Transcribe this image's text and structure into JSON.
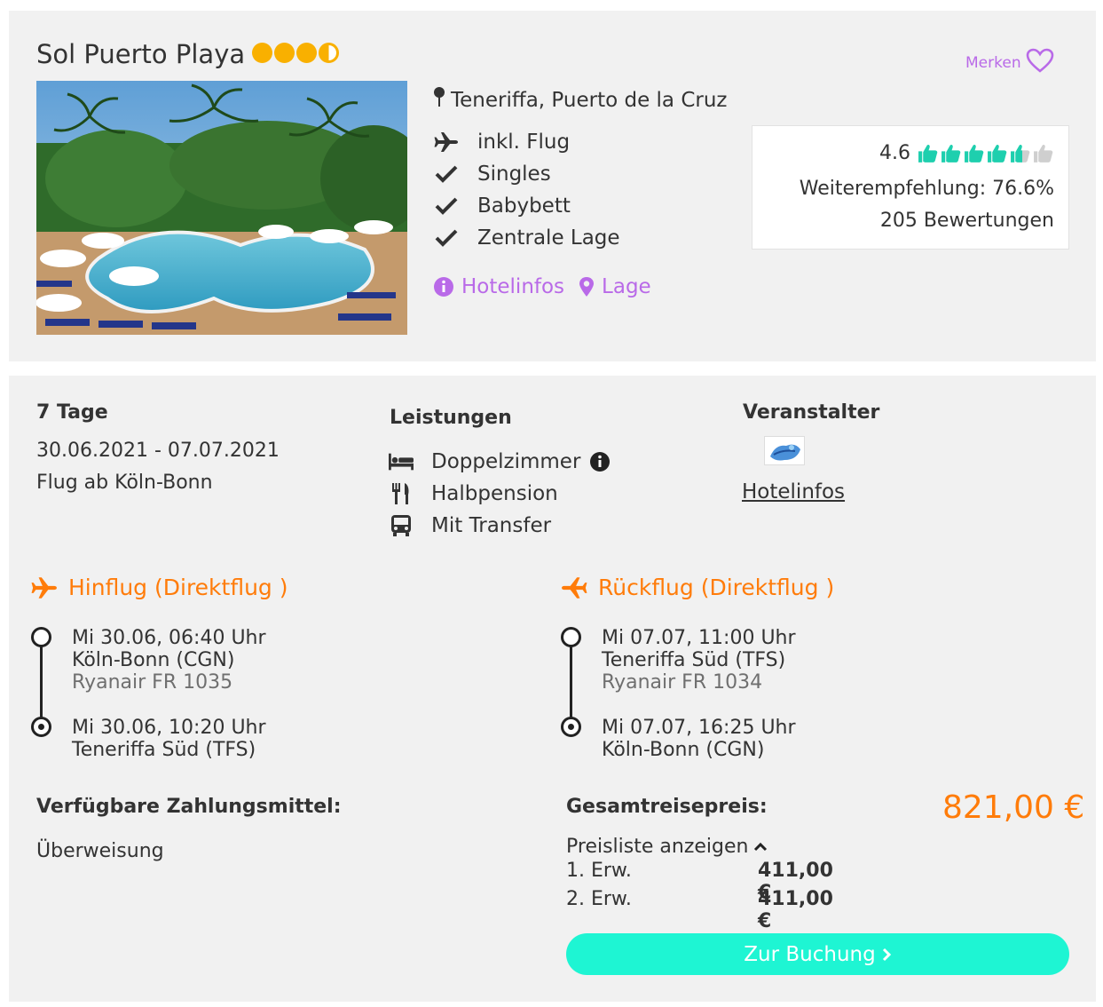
{
  "hotel": {
    "name": "Sol Puerto Playa",
    "stars": 3.5,
    "merken_label": "Merken",
    "location": "Teneriffa, Puerto de la Cruz",
    "features": [
      "inkl. Flug",
      "Singles",
      "Babybett",
      "Zentrale Lage"
    ],
    "feature_icons": [
      "plane-icon",
      "check-icon",
      "check-icon",
      "check-icon"
    ],
    "links": {
      "hotelinfos": "Hotelinfos",
      "lage": "Lage"
    },
    "rating": {
      "score": "4.6",
      "thumbs_filled": 4.6,
      "thumbs_total": 6,
      "recommendation": "Weiterempfehlung: 76.6%",
      "reviews": "205 Bewertungen"
    }
  },
  "trip": {
    "duration": "7 Tage",
    "dates": "30.06.2021 - 07.07.2021",
    "departure": "Flug ab Köln-Bonn"
  },
  "services": {
    "heading": "Leistungen",
    "items": [
      {
        "label": "Doppelzimmer",
        "icon": "bed-icon"
      },
      {
        "label": "Halbpension",
        "icon": "cutlery-icon"
      },
      {
        "label": "Mit Transfer",
        "icon": "bus-icon"
      }
    ]
  },
  "operator": {
    "heading": "Veranstalter",
    "link": "Hotelinfos"
  },
  "flights": {
    "outbound": {
      "title": "Hinflug (Direktflug )",
      "dep_time": "Mi 30.06, 06:40 Uhr",
      "dep_airport": "Köln-Bonn (CGN)",
      "carrier": "Ryanair FR 1035",
      "arr_time": "Mi 30.06, 10:20 Uhr",
      "arr_airport": "Teneriffa Süd (TFS)"
    },
    "return": {
      "title": "Rückflug (Direktflug )",
      "dep_time": "Mi 07.07, 11:00 Uhr",
      "dep_airport": "Teneriffa Süd (TFS)",
      "carrier": "Ryanair FR 1034",
      "arr_time": "Mi 07.07, 16:25 Uhr",
      "arr_airport": "Köln-Bonn (CGN)"
    }
  },
  "payment": {
    "heading": "Verfügbare Zahlungsmittel:",
    "method": "Überweisung"
  },
  "price": {
    "label": "Gesamtreisepreis:",
    "total": "821,00 €",
    "toggle": "Preisliste anzeigen",
    "rows": [
      {
        "label": "1. Erw.",
        "value": "411,00 €"
      },
      {
        "label": "2. Erw.",
        "value": "411,00 €"
      }
    ],
    "button": "Zur Buchung"
  },
  "colors": {
    "accent_purple": "#b96ae8",
    "accent_orange": "#ff7c0a",
    "button_teal": "#1ef5d3",
    "star_gold": "#f9b000",
    "thumb_green": "#1ecfae"
  }
}
